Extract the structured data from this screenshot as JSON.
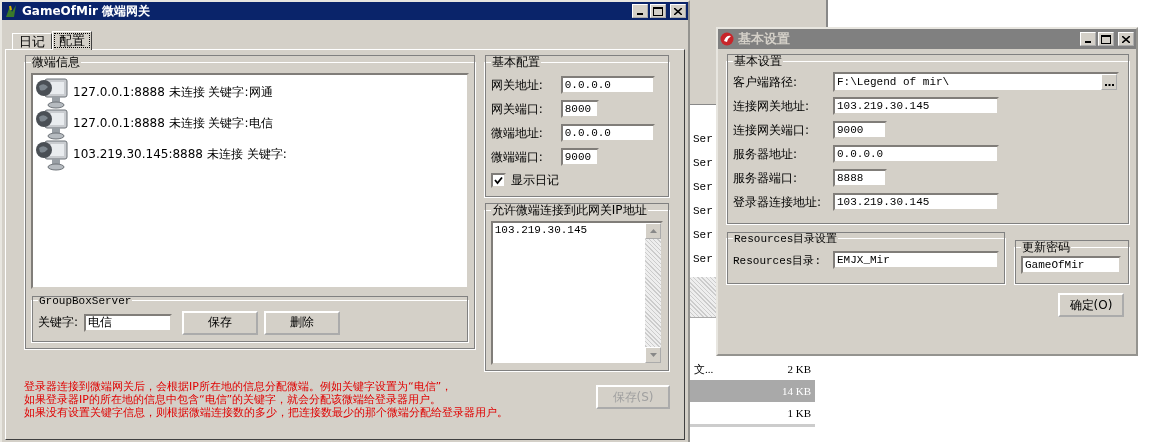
{
  "background_window": {
    "rows": [
      {
        "name": "Ser",
        "selected": false
      },
      {
        "name": "Ser",
        "selected": false
      },
      {
        "name": "Ser",
        "selected": false
      },
      {
        "name": "Ser",
        "selected": false
      },
      {
        "name": "Ser",
        "selected": false
      },
      {
        "name": "Ser",
        "selected": false
      }
    ],
    "size_rows": [
      {
        "name": "文...",
        "size": "2 KB",
        "selected": false
      },
      {
        "size": "14 KB",
        "selected": true
      },
      {
        "size": "1 KB",
        "selected": false
      }
    ]
  },
  "main_window": {
    "title": "GameOfMir 微端网关",
    "tabs": [
      {
        "label": "日记",
        "selected": false
      },
      {
        "label": "配置",
        "selected": true
      }
    ],
    "client_group": {
      "title": "微端信息",
      "items": [
        {
          "text": "127.0.0.1:8888 未连接 关键字:网通"
        },
        {
          "text": "127.0.0.1:8888 未连接 关键字:电信"
        },
        {
          "text": "103.219.30.145:8888 未连接 关键字:"
        }
      ]
    },
    "server_group": {
      "title": "GroupBoxServer",
      "keyword_label": "关键字:",
      "keyword_value": "电信",
      "buttons": [
        "保存",
        "删除"
      ]
    },
    "basic_config": {
      "title": "基本配置",
      "fields": [
        {
          "label": "网关地址:",
          "value": "0.0.0.0",
          "kind": "wide"
        },
        {
          "label": "网关端口:",
          "value": "8000",
          "kind": "narrow"
        },
        {
          "label": "微端地址:",
          "value": "0.0.0.0",
          "kind": "wide"
        },
        {
          "label": "微端端口:",
          "value": "9000",
          "kind": "narrow"
        }
      ],
      "show_log": {
        "label": "显示日记",
        "checked": true
      }
    },
    "allowed_ips": {
      "title": "允许微端连接到此网关IP地址",
      "lines": [
        "103.219.30.145"
      ]
    },
    "notes": [
      "登录器连接到微端网关后，会根据IP所在地的信息分配微端。例如关键字设置为“电信”，",
      "如果登录器IP的所在地的信息中包含“电信”的关键字，就会分配该微端给登录器用户。",
      "如果没有设置关键字信息，则根据微端连接数的多少，把连接数最少的那个微端分配给登录器用户。"
    ],
    "save_button": {
      "label": "保存(S)",
      "disabled": true
    }
  },
  "settings_dialog": {
    "title": "基本设置",
    "basic_group": {
      "title": "基本设置",
      "fields": [
        {
          "label": "客户端路径:",
          "value": "F:\\Legend of mir\\",
          "kind": "browse"
        },
        {
          "label": "连接网关地址:",
          "value": "103.219.30.145",
          "kind": "wide"
        },
        {
          "label": "连接网关端口:",
          "value": "9000",
          "kind": "narrow"
        },
        {
          "label": "服务器地址:",
          "value": "0.0.0.0",
          "kind": "wide"
        },
        {
          "label": "服务器端口:",
          "value": "8888",
          "kind": "narrow"
        },
        {
          "label": "登录器连接地址:",
          "value": "103.219.30.145",
          "kind": "wide"
        }
      ]
    },
    "resources_group": {
      "title": "Resources目录设置",
      "label": "Resources目录:",
      "value": "EMJX_Mir"
    },
    "password_group": {
      "title": "更新密码",
      "value": "GameOfMir"
    },
    "ok_button": {
      "label": "确定(O)",
      "disabled": false
    }
  }
}
